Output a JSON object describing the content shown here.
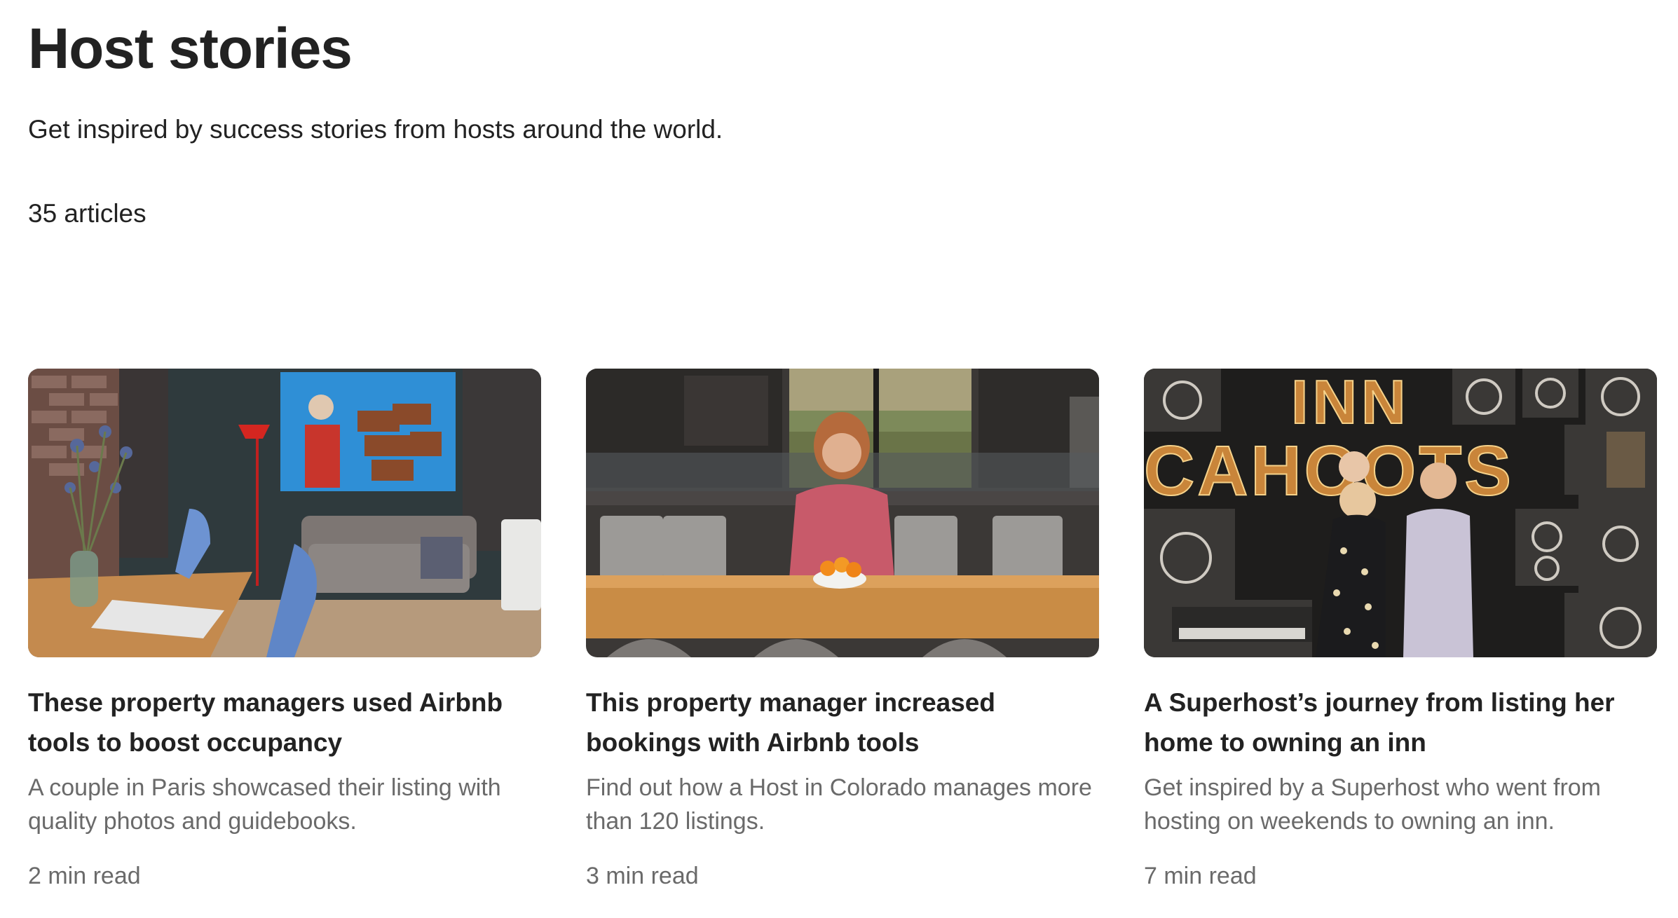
{
  "header": {
    "title": "Host stories",
    "subtitle": "Get inspired by success stories from hosts around the world.",
    "article_count": "35 articles"
  },
  "articles": [
    {
      "title": "These property managers used Airbnb tools to boost occupancy",
      "description": "A couple in Paris showcased their listing with quality photos and guidebooks.",
      "read_time": "2 min read",
      "image": "living-room-photo"
    },
    {
      "title": "This property manager increased bookings with Airbnb tools",
      "description": "Find out how a Host in Colorado manages more than 120 listings.",
      "read_time": "3 min read",
      "image": "kitchen-host-photo"
    },
    {
      "title": "A Superhost’s journey from listing her home to owning an inn",
      "description": "Get inspired by a Superhost who went from hosting on weekends to owning an inn.",
      "read_time": "7 min read",
      "image": "inn-cahoots-photo",
      "image_sign_text": [
        "INN",
        "CAHOOTS"
      ]
    }
  ],
  "colors": {
    "text_primary": "#222222",
    "text_secondary": "#6a6a6a",
    "background": "#ffffff"
  }
}
